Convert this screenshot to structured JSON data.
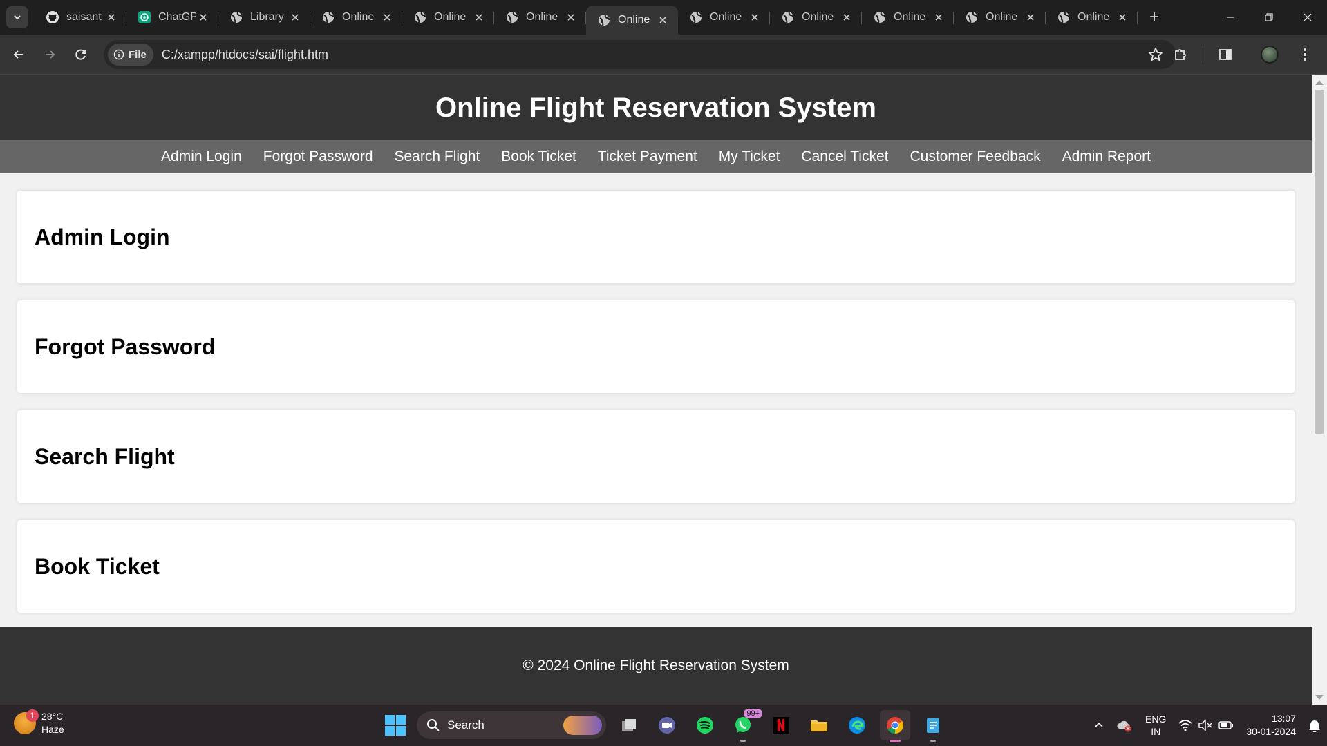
{
  "browser": {
    "tabs": [
      {
        "title": "saisant",
        "favicon": "github-icon",
        "active": false
      },
      {
        "title": "ChatGPT",
        "favicon": "chatgpt-icon",
        "active": false
      },
      {
        "title": "Library",
        "favicon": "globe-icon",
        "active": false
      },
      {
        "title": "Online",
        "favicon": "globe-icon",
        "active": false
      },
      {
        "title": "Online",
        "favicon": "globe-icon",
        "active": false
      },
      {
        "title": "Online",
        "favicon": "globe-icon",
        "active": false
      },
      {
        "title": "Online",
        "favicon": "globe-icon",
        "active": true
      },
      {
        "title": "Online",
        "favicon": "globe-icon",
        "active": false
      },
      {
        "title": "Online",
        "favicon": "globe-icon",
        "active": false
      },
      {
        "title": "Online",
        "favicon": "globe-icon",
        "active": false
      },
      {
        "title": "Online",
        "favicon": "globe-icon",
        "active": false
      },
      {
        "title": "Online",
        "favicon": "globe-icon",
        "active": false
      }
    ],
    "address": {
      "chip_label": "File",
      "url": "C:/xampp/htdocs/sai/flight.htm"
    }
  },
  "page": {
    "title": "Online Flight Reservation System",
    "nav": [
      "Admin Login",
      "Forgot Password",
      "Search Flight",
      "Book Ticket",
      "Ticket Payment",
      "My Ticket",
      "Cancel Ticket",
      "Customer Feedback",
      "Admin Report"
    ],
    "sections": [
      "Admin Login",
      "Forgot Password",
      "Search Flight",
      "Book Ticket"
    ],
    "footer": "© 2024 Online Flight Reservation System"
  },
  "taskbar": {
    "weather": {
      "temp": "28°C",
      "condition": "Haze",
      "badge": "1"
    },
    "search_label": "Search",
    "whatsapp_badge": "99+",
    "language": {
      "line1": "ENG",
      "line2": "IN"
    },
    "clock": {
      "time": "13:07",
      "date": "30-01-2024"
    }
  },
  "colors": {
    "header_bg": "#333333",
    "nav_bg": "#666666",
    "page_bg": "#f1f1f1",
    "card_bg": "#ffffff"
  }
}
